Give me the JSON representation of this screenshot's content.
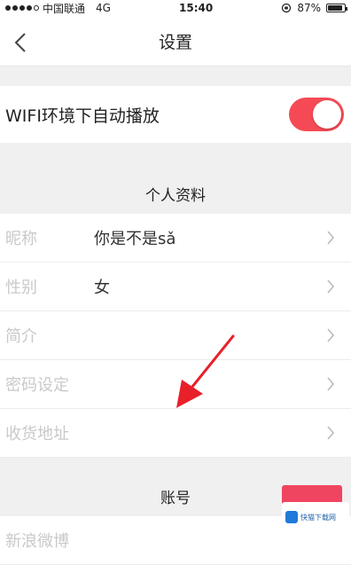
{
  "status_bar": {
    "carrier": "中国联通",
    "network": "4G",
    "time": "15:40",
    "battery": "87%",
    "battery_level": 0.87
  },
  "nav": {
    "title": "设置"
  },
  "wifi": {
    "label": "WIFI环境下自动播放",
    "enabled": true
  },
  "profile_section": {
    "title": "个人资料"
  },
  "profile_rows": [
    {
      "label": "昵称",
      "value": "你是不是sǎ"
    },
    {
      "label": "性别",
      "value": "女"
    },
    {
      "label": "简介",
      "value": ""
    },
    {
      "label": "密码设定",
      "value": ""
    },
    {
      "label": "收货地址",
      "value": ""
    }
  ],
  "account_section": {
    "title": "账号"
  },
  "account_rows": [
    {
      "label": "新浪微博"
    }
  ],
  "watermark": {
    "text": "快猫下载网"
  }
}
